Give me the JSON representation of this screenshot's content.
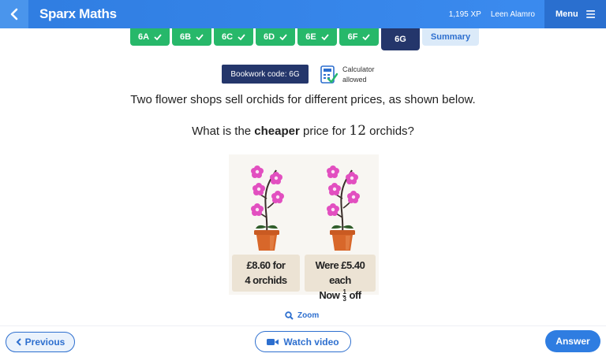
{
  "header": {
    "brand": "Sparx Maths",
    "xp": "1,195 XP",
    "user": "Leen Alamro",
    "menu_label": "Menu"
  },
  "tabs": [
    {
      "label": "6A",
      "done": true
    },
    {
      "label": "6B",
      "done": true
    },
    {
      "label": "6C",
      "done": true
    },
    {
      "label": "6D",
      "done": true
    },
    {
      "label": "6E",
      "done": true
    },
    {
      "label": "6F",
      "done": true
    },
    {
      "label": "6G",
      "active": true
    },
    {
      "label": "Summary"
    }
  ],
  "bookwork": "Bookwork code: 6G",
  "calculator": {
    "line1": "Calculator",
    "line2": "allowed"
  },
  "question": {
    "line1": "Two flower shops sell orchids for different prices, as shown below.",
    "line2_before": "What is the ",
    "line2_bold": "cheaper",
    "line2_mid": " price for ",
    "line2_num": "12",
    "line2_after": " orchids?"
  },
  "figure": {
    "card1_line1": "£8.60 for",
    "card1_line2": "4 orchids",
    "card2_line1": "Were £5.40 each",
    "card2_now": "Now",
    "card2_frac_top": "1",
    "card2_frac_bottom": "3",
    "card2_off": "off"
  },
  "zoom_label": "Zoom",
  "buttons": {
    "previous": "Previous",
    "watch": "Watch video",
    "answer": "Answer"
  },
  "colors": {
    "brand_blue": "#2f7de1",
    "tab_green": "#27b86a",
    "navy": "#24366b",
    "flower_pink": "#e24fc0",
    "pot": "#d8672a"
  }
}
